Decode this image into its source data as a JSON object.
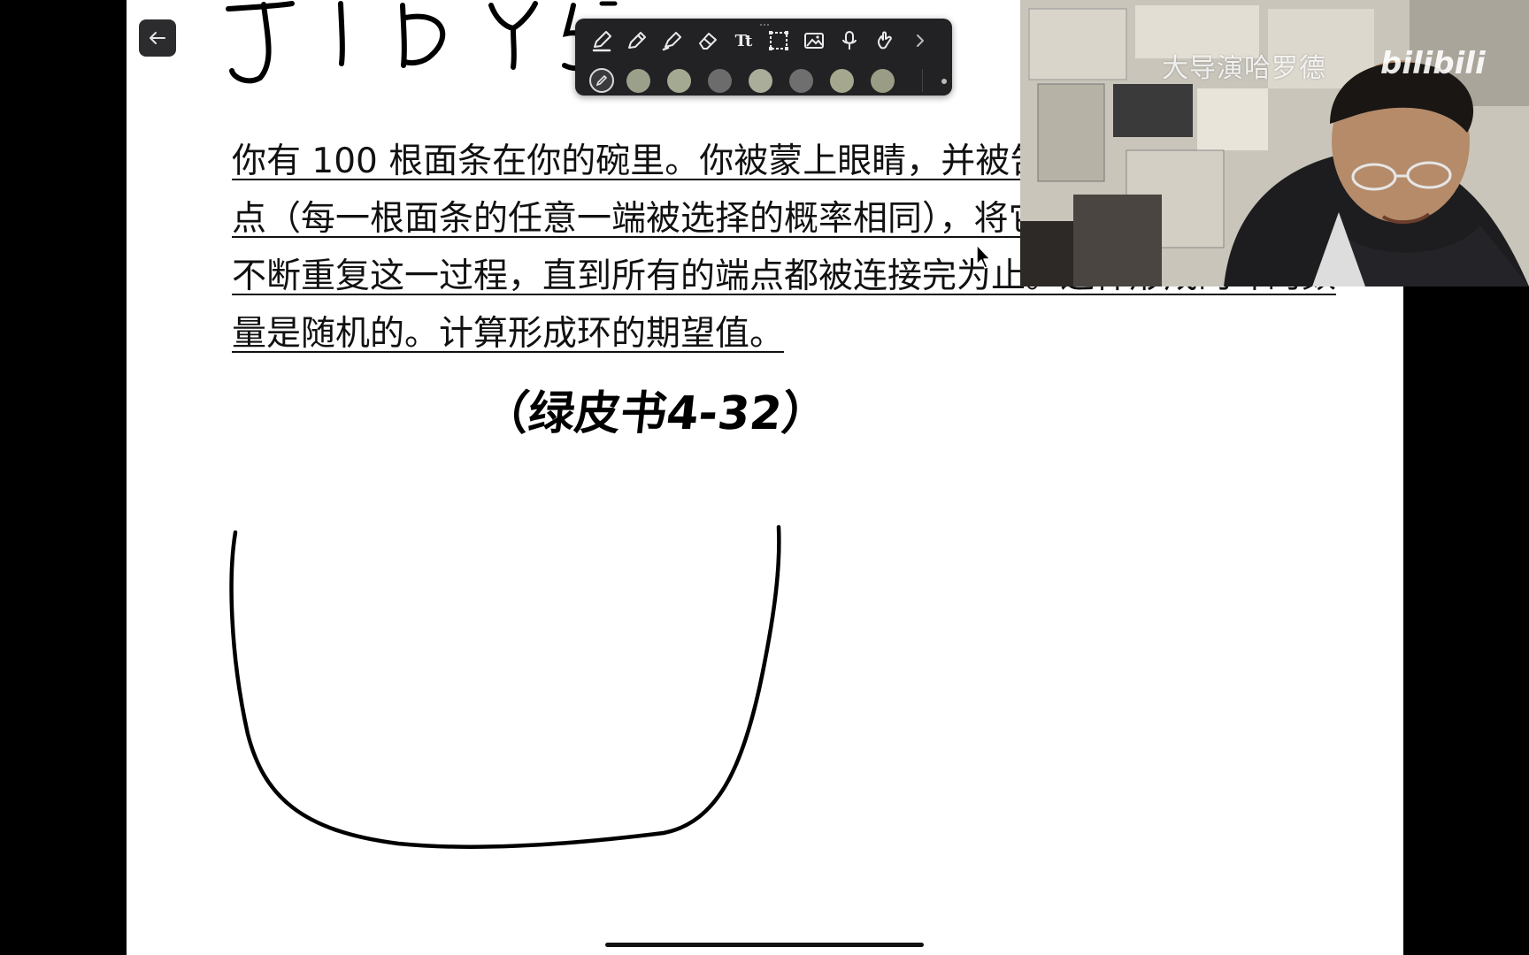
{
  "problem": {
    "text": "你有 100 根面条在你的碗里。你被蒙上眼睛，并被告知随机拿起两个端点（每一根面条的任意一端被选择的概率相同），将它们连接在一起。你不断重复这一过程，直到所有的端点都被连接完为止。这样形成的环的数量是随机的。计算形成环的期望值。"
  },
  "handwritten_note": "（绿皮书4-32）",
  "webcam": {
    "watermark": "大导演哈罗德",
    "logo": "bilibili"
  },
  "toolbar": {
    "tools": [
      "pen-icon",
      "pencil-icon",
      "highlighter-icon",
      "eraser-icon",
      "text-icon",
      "lasso-icon",
      "image-icon",
      "microphone-icon",
      "touch-icon",
      "chevron-right-icon"
    ],
    "text_tool_label": "Tt",
    "swatch_colors": [
      "#9aa08a",
      "#a4a992",
      "#6c6c6c",
      "#a9ad9a",
      "#6f6f6f",
      "#a5a88f",
      "#9a9c86"
    ]
  },
  "colors": {
    "page": "#ffffff",
    "background": "#000000",
    "toolbar": "#222224",
    "ink": "#111111"
  }
}
